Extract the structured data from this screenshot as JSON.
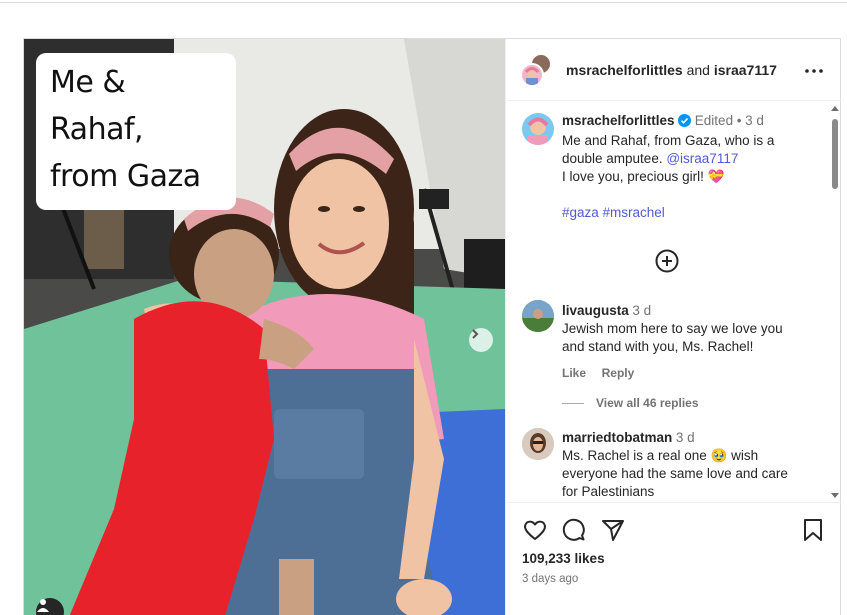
{
  "overlay": {
    "line1": "Me & Rahaf,",
    "line2": "from Gaza"
  },
  "header": {
    "user1": "msrachelforlittles",
    "joiner": "and",
    "user2": "israa7117"
  },
  "caption": {
    "user": "msrachelforlittles",
    "edited": "Edited",
    "dot": "•",
    "time": "3 d",
    "text1": "Me and Rahaf, from Gaza, who is a",
    "text2a": "double amputee.",
    "mention": "@israa7117",
    "text3": "I love you, precious girl! 💝",
    "hashtags": "#gaza #msrachel"
  },
  "comments": [
    {
      "user": "livaugusta",
      "time": "3 d",
      "line1": "Jewish mom here to say we love you",
      "line2": "and stand with you, Ms. Rachel!",
      "like": "Like",
      "reply": "Reply",
      "view_replies": "View all 46 replies"
    },
    {
      "user": "marriedtobatman",
      "time": "3 d",
      "line1": "Ms. Rachel is a real one 🥹 wish",
      "line2": "everyone had the same love and care",
      "line3": "for Palestinians"
    }
  ],
  "stats": {
    "likes": "109,233 likes",
    "ago": "3 days ago"
  },
  "colors": {
    "verified": "#0095f6",
    "link": "#4f5bd5",
    "text": "#262626",
    "muted": "#737373"
  },
  "icons": [
    "next-arrow-icon",
    "tag-people-icon",
    "more-icon",
    "verified-icon",
    "add-comment-icon",
    "heart-icon",
    "comment-icon",
    "share-icon",
    "bookmark-icon"
  ]
}
